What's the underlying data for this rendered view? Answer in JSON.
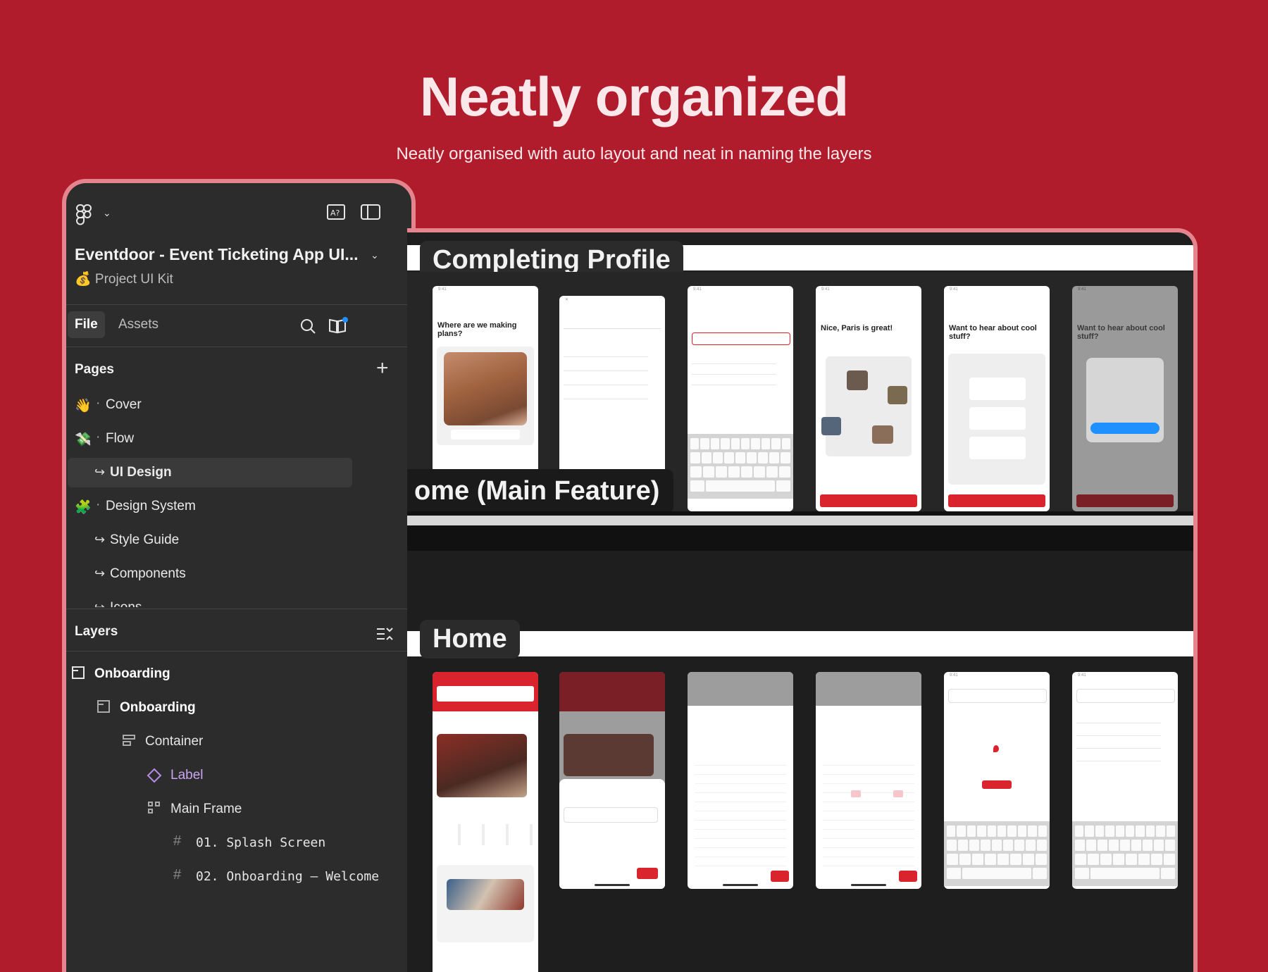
{
  "hero": {
    "title": "Neatly organized",
    "subtitle": "Neatly organised with auto layout and neat in naming the layers"
  },
  "sidebar": {
    "file_name": "Eventdoor - Event Ticketing App UI...",
    "file_sub": "💰 Project UI Kit",
    "tabs": {
      "file": "File",
      "assets": "Assets"
    },
    "pages_title": "Pages",
    "pages": [
      {
        "icon": "👋",
        "label": "Cover"
      },
      {
        "icon": "💸",
        "label": "Flow"
      },
      {
        "label": "UI Design"
      },
      {
        "icon": "🧩",
        "label": "Design System"
      },
      {
        "label": "Style Guide"
      },
      {
        "label": "Components"
      },
      {
        "label": "Icons"
      }
    ],
    "layers_title": "Layers",
    "layers": [
      {
        "label": "Onboarding"
      },
      {
        "label": "Onboarding"
      },
      {
        "label": "Container"
      },
      {
        "label": "Label"
      },
      {
        "label": "Main Frame"
      },
      {
        "label": "01. Splash Screen"
      },
      {
        "label": "02. Onboarding – Welcome"
      }
    ]
  },
  "canvas": {
    "section1": "Completing Profile",
    "section2": "ome (Main Feature)",
    "section3": "Home",
    "profile_screens": [
      "Where are we making plans?",
      "",
      "",
      "Nice, Paris is great!",
      "Want to hear about cool stuff?",
      "Want to hear about cool stuff?"
    ]
  },
  "colors": {
    "background": "#b01c2c",
    "accent": "#d9232d",
    "panel": "#2c2c2c"
  }
}
